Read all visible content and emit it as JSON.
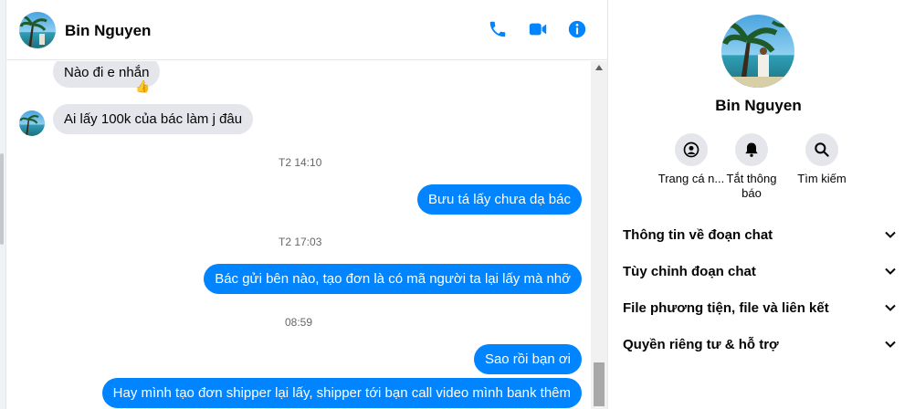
{
  "contact": {
    "name": "Bin Nguyen"
  },
  "header": {
    "call_icon": "phone-icon",
    "video_icon": "video-camera-icon",
    "info_icon": "info-icon"
  },
  "messages": [
    {
      "side": "in",
      "text": "Nào đi e nhắn",
      "reaction": "👍"
    },
    {
      "side": "in",
      "text": "Ai lấy 100k của bác làm j đâu"
    },
    {
      "side": "time",
      "text": "T2 14:10"
    },
    {
      "side": "out",
      "text": "Bưu tá lấy chưa dạ bác"
    },
    {
      "side": "time",
      "text": "T2 17:03"
    },
    {
      "side": "out",
      "text": "Bác gửi bên nào, tạo đơn là có mã người ta lại lấy mà nhỡ"
    },
    {
      "side": "time",
      "text": "08:59"
    },
    {
      "side": "out",
      "text": "Sao rồi bạn ơi"
    },
    {
      "side": "out",
      "text": "Hay mình tạo đơn shipper lại lấy, shipper tới bạn call video mình bank thêm"
    }
  ],
  "info_panel": {
    "name": "Bin Nguyen",
    "actions": [
      {
        "label": "Trang cá n...",
        "icon": "profile-icon"
      },
      {
        "label": "Tắt thông báo",
        "icon": "bell-icon"
      },
      {
        "label": "Tìm kiếm",
        "icon": "search-icon"
      }
    ],
    "sections": [
      "Thông tin về đoạn chat",
      "Tùy chỉnh đoạn chat",
      "File phương tiện, file và liên kết",
      "Quyền riêng tư & hỗ trợ"
    ]
  },
  "colors": {
    "accent": "#0084ff",
    "incoming": "#e4e6eb",
    "secondary_text": "#65676b"
  }
}
